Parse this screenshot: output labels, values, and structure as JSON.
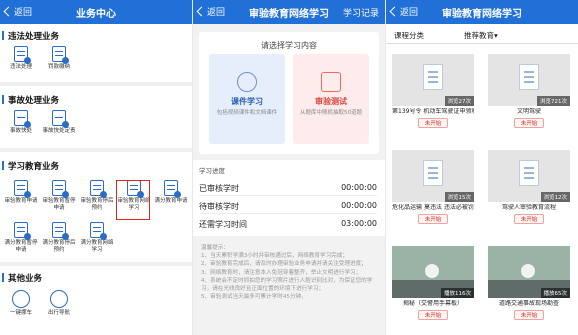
{
  "colors": {
    "primary": "#2170d8",
    "highlight": "#e0251b"
  },
  "panel1": {
    "back": "返回",
    "title": "业务中心",
    "sections": [
      {
        "title": "违法处理业务",
        "items": [
          "违法处理",
          "罚款缴纳"
        ]
      },
      {
        "title": "事故处理业务",
        "items": [
          "事故快处",
          "事故快处定责"
        ]
      },
      {
        "title": "学习教育业务",
        "items": [
          "审验教育申请",
          "审验教育暂停申请",
          "审验教育停后预约",
          "审验教育网络学习",
          "满分教育申请",
          "满分教育暂停申请",
          "满分教育停后预约",
          "满分教育网络学习"
        ]
      },
      {
        "title": "其他业务",
        "items": [
          "一键挪车",
          "出行导航"
        ]
      }
    ]
  },
  "panel2": {
    "back": "返回",
    "title": "审验教育网络学习",
    "right": "学习记录",
    "choose_title": "请选择学习内容",
    "study_card": {
      "title": "课件学习",
      "desc": "包括视频课件和文档课件"
    },
    "test_card": {
      "title": "审验测试",
      "desc": "从题库中随机抽取50道题"
    },
    "progress_title": "学习进度",
    "rows": [
      {
        "label": "已审核学时",
        "value": "00:00:00"
      },
      {
        "label": "待审核学时",
        "value": "00:00:00"
      },
      {
        "label": "还需学习时间",
        "value": "03:00:00"
      }
    ],
    "notes_title": "温馨提示：",
    "notes": [
      "1、当天累积学满3小时并审核通过后，网络教育学习完成；",
      "2、审验教育完成后，请及时办理审验业务申请并请关注受理进度；",
      "3、网络教育时，请注意本人免冠穿着整齐，举止文明进行学习；",
      "4、系统会不定时抓拍您的学习照片进行人脸识别比对，为保证您的学习，请在光线良好且正面位置的环境下进行学习；",
      "5、审验测试当天最多可累计学时45分钟。"
    ]
  },
  "panel3": {
    "back": "返回",
    "title": "审验教育网络学习",
    "filter_category": "课程分类",
    "filter_recommend": "推荐教育▾",
    "courses": [
      {
        "badge": "浏览27次",
        "name": "第139号令 机动车驾驶证申领和使用规定",
        "status": "未开始",
        "type": "doc"
      },
      {
        "badge": "浏览721次",
        "name": "文明驾驶",
        "status": "未开始",
        "type": "doc"
      },
      {
        "badge": "浏览15次",
        "name": "危化品运输 莫违法 违法必被罚",
        "status": "未开始",
        "type": "doc"
      },
      {
        "badge": "浏览12次",
        "name": "驾驶人审验教育流程",
        "status": "未开始",
        "type": "doc"
      },
      {
        "badge": "播放116次",
        "name": "揭秘（交警用手幕板）",
        "status": "未开始",
        "type": "video"
      },
      {
        "badge": "播放65次",
        "name": "道路交通事故现场勘查",
        "status": "未开始",
        "type": "video"
      }
    ]
  }
}
